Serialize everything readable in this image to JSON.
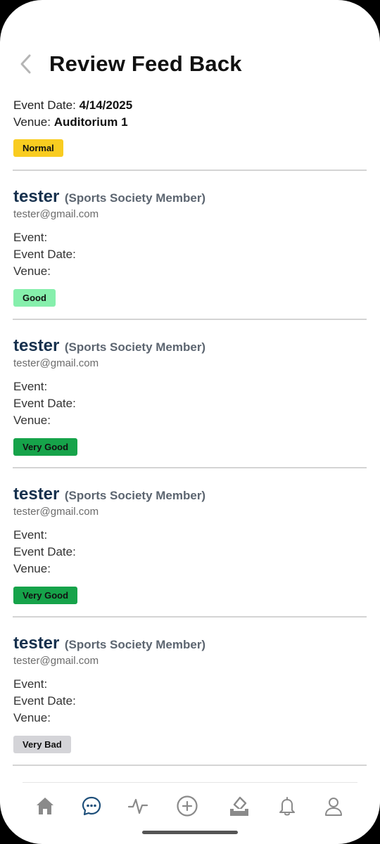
{
  "header": {
    "title": "Review Feed Back"
  },
  "summary": {
    "event_date_label": "Event Date:",
    "event_date_value": "4/14/2025",
    "venue_label": "Venue:",
    "venue_value": "Auditorium 1",
    "status": "Normal",
    "status_color": "#f9cc20"
  },
  "reviews": [
    {
      "name": "tester",
      "role": "(Sports Society Member)",
      "email": "tester@gmail.com",
      "event_label": "Event:",
      "event_date_label": "Event Date:",
      "venue_label": "Venue:",
      "rating": "Good",
      "rating_color": "#86efac"
    },
    {
      "name": "tester",
      "role": "(Sports Society Member)",
      "email": "tester@gmail.com",
      "event_label": "Event:",
      "event_date_label": "Event Date:",
      "venue_label": "Venue:",
      "rating": "Very Good",
      "rating_color": "#16a34a"
    },
    {
      "name": "tester",
      "role": "(Sports Society Member)",
      "email": "tester@gmail.com",
      "event_label": "Event:",
      "event_date_label": "Event Date:",
      "venue_label": "Venue:",
      "rating": "Very Good",
      "rating_color": "#16a34a"
    },
    {
      "name": "tester",
      "role": "(Sports Society Member)",
      "email": "tester@gmail.com",
      "event_label": "Event:",
      "event_date_label": "Event Date:",
      "venue_label": "Venue:",
      "rating": "Very Bad",
      "rating_color": "#d4d4d8"
    }
  ],
  "tabs": [
    {
      "icon": "home-icon",
      "active": false
    },
    {
      "icon": "chat-icon",
      "active": true
    },
    {
      "icon": "activity-icon",
      "active": false
    },
    {
      "icon": "add-circle-icon",
      "active": false
    },
    {
      "icon": "vote-box-icon",
      "active": false
    },
    {
      "icon": "bell-icon",
      "active": false
    },
    {
      "icon": "user-icon",
      "active": false
    }
  ],
  "colors": {
    "accent": "#16304d",
    "active_tab": "#1e4f7a",
    "inactive_tab": "#8a8a8a"
  }
}
